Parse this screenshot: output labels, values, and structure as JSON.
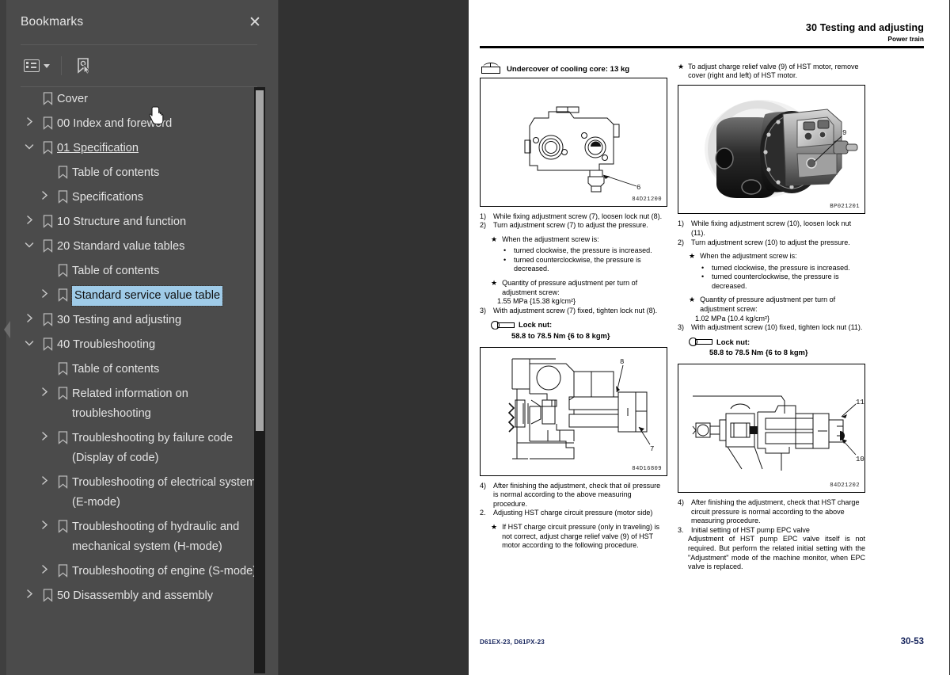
{
  "sidebar": {
    "title": "Bookmarks",
    "close_icon": "close-icon",
    "toolbar": {
      "options_label": "list-options-dropdown",
      "new_bookmark_label": "new-bookmark"
    },
    "items": [
      {
        "label": "Cover",
        "depth": 0,
        "twisty": "none",
        "selected": false,
        "link": false
      },
      {
        "label": "00 Index and foreword",
        "depth": 0,
        "twisty": "collapsed",
        "selected": false,
        "link": false
      },
      {
        "label": "01 Specification ",
        "depth": 0,
        "twisty": "expanded",
        "selected": false,
        "link": true
      },
      {
        "label": "Table of contents",
        "depth": 1,
        "twisty": "none",
        "selected": false,
        "link": false
      },
      {
        "label": "Specifications",
        "depth": 1,
        "twisty": "collapsed",
        "selected": false,
        "link": false
      },
      {
        "label": "10 Structure and function",
        "depth": 0,
        "twisty": "collapsed",
        "selected": false,
        "link": false
      },
      {
        "label": "20 Standard value tables",
        "depth": 0,
        "twisty": "expanded",
        "selected": false,
        "link": false
      },
      {
        "label": "Table of contents",
        "depth": 1,
        "twisty": "none",
        "selected": false,
        "link": false
      },
      {
        "label": "Standard service value table",
        "depth": 1,
        "twisty": "collapsed",
        "selected": true,
        "link": false
      },
      {
        "label": "30 Testing and adjusting",
        "depth": 0,
        "twisty": "collapsed",
        "selected": false,
        "link": false
      },
      {
        "label": "40 Troubleshooting",
        "depth": 0,
        "twisty": "expanded",
        "selected": false,
        "link": false
      },
      {
        "label": "Table of contents",
        "depth": 1,
        "twisty": "none",
        "selected": false,
        "link": false
      },
      {
        "label": "Related information on troubleshooting",
        "depth": 1,
        "twisty": "collapsed",
        "selected": false,
        "link": false
      },
      {
        "label": "Troubleshooting by failure code (Display of code)",
        "depth": 1,
        "twisty": "collapsed",
        "selected": false,
        "link": false
      },
      {
        "label": "Troubleshooting of electrical system (E-mode)",
        "depth": 1,
        "twisty": "collapsed",
        "selected": false,
        "link": false
      },
      {
        "label": "Troubleshooting of hydraulic and mechanical system (H-mode)",
        "depth": 1,
        "twisty": "collapsed",
        "selected": false,
        "link": false
      },
      {
        "label": "Troubleshooting of engine (S-mode)",
        "depth": 1,
        "twisty": "collapsed",
        "selected": false,
        "link": false
      },
      {
        "label": "50 Disassembly and assembly",
        "depth": 0,
        "twisty": "collapsed",
        "selected": false,
        "link": false
      }
    ]
  },
  "viewer": {
    "collapse_handle": "collapse-sidebar-handle"
  },
  "page": {
    "header": {
      "line1": "30 Testing and adjusting",
      "line2": "Power train"
    },
    "left": {
      "lift_note": "Undercover of cooling core: 13 kg",
      "figure_id": "84D21200",
      "figure_callouts": [
        "6"
      ],
      "steps": [
        {
          "n": "1)",
          "t": "While fixing adjustment screw (7), loosen lock nut (8)."
        },
        {
          "n": "2)",
          "t": "Turn adjustment screw (7) to adjust the pressure."
        }
      ],
      "star1": "When the adjustment screw is:",
      "bullets": [
        "turned clockwise, the pressure is increased.",
        "turned counterclockwise, the pressure is decreased."
      ],
      "star2": "Quantity of pressure adjustment per turn of adjustment screw:",
      "star2_value": "1.55 MPa {15.38 kg/cm²}",
      "step3": {
        "n": "3)",
        "t": "With adjustment screw (7) fixed, tighten lock nut (8)."
      },
      "torque_label": "Lock nut:",
      "torque_value": "58.8 to 78.5 Nm {6 to 8 kgm}",
      "figure2_id": "84D16809",
      "figure2_callouts": [
        "8",
        "7"
      ],
      "step4": {
        "n": "4)",
        "t": "After finishing the adjustment, check that oil pressure is normal according to the above measuring procedure."
      },
      "section2": {
        "n": "2.",
        "t": "Adjusting HST charge circuit pressure (motor side)"
      },
      "star3": "If HST charge circuit pressure (only in traveling) is not correct, adjust charge relief valve (9) of HST motor according to the following procedure."
    },
    "right": {
      "star_top": "To adjust charge relief valve (9) of HST motor, remove cover (right and left) of HST motor.",
      "figure_id": "BP021201",
      "figure_callouts": [
        "9"
      ],
      "steps": [
        {
          "n": "1)",
          "t": "While fixing adjustment screw (10), loosen lock nut (11)."
        },
        {
          "n": "2)",
          "t": "Turn adjustment screw (10) to adjust the pressure."
        }
      ],
      "star1": "When the adjustment screw is:",
      "bullets": [
        "turned clockwise, the pressure is increased.",
        "turned counterclockwise, the pressure is decreased."
      ],
      "star2": "Quantity of pressure adjustment per turn of adjustment screw:",
      "star2_value": "1.02 MPa {10.4 kg/cm²}",
      "step3": {
        "n": "3)",
        "t": "With adjustment screw (10) fixed, tighten lock nut (11)."
      },
      "torque_label": "Lock nut:",
      "torque_value": "58.8 to 78.5 Nm {6 to 8 kgm}",
      "figure2_id": "84D21202",
      "figure2_callouts": [
        "11",
        "10"
      ],
      "step4": {
        "n": "4)",
        "t": "After finishing the adjustment, check that HST charge circuit pressure is normal according to the above measuring procedure."
      },
      "section3": {
        "n": "3.",
        "t": "Initial setting of HST pump EPC valve"
      },
      "section3_body": "Adjustment of HST pump EPC valve itself is not required. But perform the related initial setting with the \"Adjustment\" mode of the machine monitor, when EPC valve is replaced."
    },
    "footer": {
      "left": "D61EX-23, D61PX-23",
      "right": "30-53"
    }
  }
}
